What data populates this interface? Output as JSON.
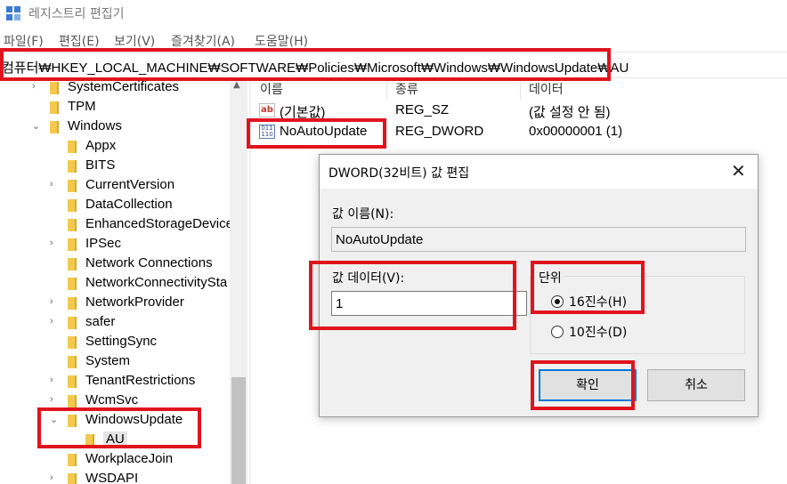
{
  "window": {
    "title": "레지스트리 편집기"
  },
  "menu": [
    "파일(F)",
    "편집(E)",
    "보기(V)",
    "즐겨찾기(A)",
    "도움말(H)"
  ],
  "address": {
    "path": "컴퓨터₩HKEY_LOCAL_MACHINE₩SOFTWARE₩Policies₩Microsoft₩Windows₩WindowsUpdate₩AU"
  },
  "tree": {
    "items": [
      {
        "label": "SystemCertificates",
        "chevron": ">"
      },
      {
        "label": "TPM",
        "chevron": ""
      },
      {
        "label": "Windows",
        "chevron": "v"
      },
      {
        "label": "Appx",
        "chevron": ""
      },
      {
        "label": "BITS",
        "chevron": ""
      },
      {
        "label": "CurrentVersion",
        "chevron": ">"
      },
      {
        "label": "DataCollection",
        "chevron": ""
      },
      {
        "label": "EnhancedStorageDevice",
        "chevron": ""
      },
      {
        "label": "IPSec",
        "chevron": ">"
      },
      {
        "label": "Network Connections",
        "chevron": ""
      },
      {
        "label": "NetworkConnectivitySta",
        "chevron": ""
      },
      {
        "label": "NetworkProvider",
        "chevron": ">"
      },
      {
        "label": "safer",
        "chevron": ">"
      },
      {
        "label": "SettingSync",
        "chevron": ""
      },
      {
        "label": "System",
        "chevron": ""
      },
      {
        "label": "TenantRestrictions",
        "chevron": ">"
      },
      {
        "label": "WcmSvc",
        "chevron": ">"
      },
      {
        "label": "WindowsUpdate",
        "chevron": "v"
      },
      {
        "label": "AU",
        "chevron": ""
      },
      {
        "label": "WorkplaceJoin",
        "chevron": ""
      },
      {
        "label": "WSDAPI",
        "chevron": ">"
      }
    ]
  },
  "list": {
    "headers": {
      "name": "이름",
      "type": "종류",
      "data": "데이터"
    },
    "rows": [
      {
        "icon": "string-value-icon",
        "icon_text": "ab",
        "name": "(기본값)",
        "type": "REG_SZ",
        "data": "(값 설정 안 됨)"
      },
      {
        "icon": "dword-value-icon",
        "icon_text": "011 110",
        "name": "NoAutoUpdate",
        "type": "REG_DWORD",
        "data": "0x00000001 (1)"
      }
    ]
  },
  "dialog": {
    "title": "DWORD(32비트) 값 편집",
    "close_glyph": "✕",
    "value_name_label": "값 이름(N):",
    "value_name": "NoAutoUpdate",
    "value_data_label": "값 데이터(V):",
    "value_data": "1",
    "base_label": "단위",
    "radio_hex": "16진수(H)",
    "radio_dec": "10진수(D)",
    "selected_base": "hex",
    "ok_label": "확인",
    "cancel_label": "취소"
  },
  "colors": {
    "highlight": "#e0141e",
    "folder": "#f2c94c",
    "focus": "#0078d7"
  }
}
